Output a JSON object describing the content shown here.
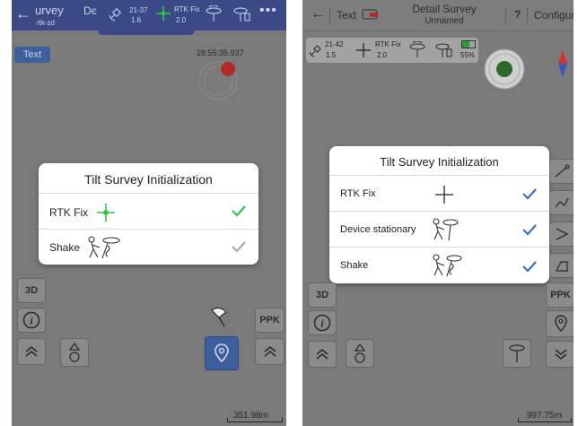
{
  "left": {
    "header": {
      "title": "urvey",
      "subtitle": "rtk-zd",
      "fix_label": "RTK Fix",
      "sats": "21-37",
      "pdop": "1.6",
      "hrms": "2.0"
    },
    "text_button": "Text",
    "timestamp": "28:55:35.937",
    "dialog": {
      "title": "Tilt Survey Initialization",
      "rows": [
        {
          "label": "RTK Fix",
          "status": "done"
        },
        {
          "label": "Shake",
          "status": "pending"
        }
      ]
    },
    "buttons": {
      "view_3d": "3D",
      "ppk": "PPK"
    },
    "scale": "351.98m",
    "colors": {
      "header": "#3b4a86",
      "fix_green": "#35c24a",
      "active_button": "#3d5f9c"
    }
  },
  "right": {
    "header": {
      "title": "Detail Survey",
      "subtitle": "Unnamed",
      "text_label": "Text",
      "help": "?",
      "configure": "Configure"
    },
    "status": {
      "sats": "21-42",
      "pdop": "1.5",
      "fix_label": "RTK Fix",
      "hrms": "2.0",
      "battery": "55%"
    },
    "dialog": {
      "title": "Tilt Survey Initialization",
      "rows": [
        {
          "label": "RTK Fix"
        },
        {
          "label": "Device stationary"
        },
        {
          "label": "Shake"
        }
      ]
    },
    "buttons": {
      "view_3d": "3D",
      "ppk": "PPK"
    },
    "scale": "997.75m",
    "colors": {
      "check_blue": "#3a6fd0",
      "compass_red": "#d83030",
      "compass_blue": "#3557b8"
    }
  }
}
